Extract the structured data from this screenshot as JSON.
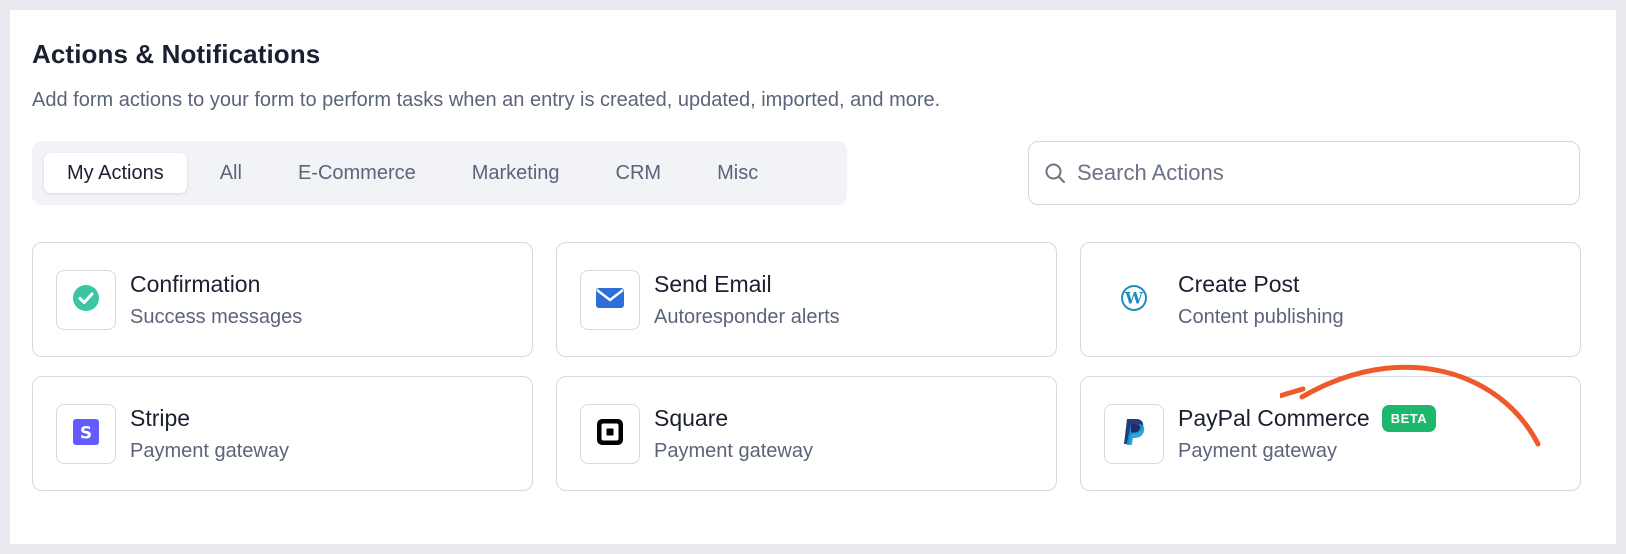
{
  "header": {
    "title": "Actions & Notifications",
    "subtitle": "Add form actions to your form to perform tasks when an entry is created, updated, imported, and more."
  },
  "tabs": [
    {
      "label": "My Actions",
      "active": true
    },
    {
      "label": "All",
      "active": false
    },
    {
      "label": "E-Commerce",
      "active": false
    },
    {
      "label": "Marketing",
      "active": false
    },
    {
      "label": "CRM",
      "active": false
    },
    {
      "label": "Misc",
      "active": false
    }
  ],
  "search": {
    "placeholder": "Search Actions",
    "value": "",
    "icon": "search-icon"
  },
  "actions": [
    {
      "name": "Confirmation",
      "description": "Success messages",
      "icon": "check-circle-icon",
      "color": "#3cc5a3"
    },
    {
      "name": "Send Email",
      "description": "Autoresponder alerts",
      "icon": "envelope-icon",
      "color": "#2d6fd6"
    },
    {
      "name": "Create Post",
      "description": "Content publishing",
      "icon": "wordpress-icon",
      "color": "#1e8cbe"
    },
    {
      "name": "Stripe",
      "description": "Payment gateway",
      "icon": "stripe-icon",
      "color": "#635bff"
    },
    {
      "name": "Square",
      "description": "Payment gateway",
      "icon": "square-icon",
      "color": "#000000"
    },
    {
      "name": "PayPal Commerce",
      "description": "Payment gateway",
      "icon": "paypal-icon",
      "color": "#253b80",
      "badge": "BETA"
    }
  ],
  "colors": {
    "badge": "#1db86b",
    "annotation_arrow": "#ee5a2b"
  }
}
